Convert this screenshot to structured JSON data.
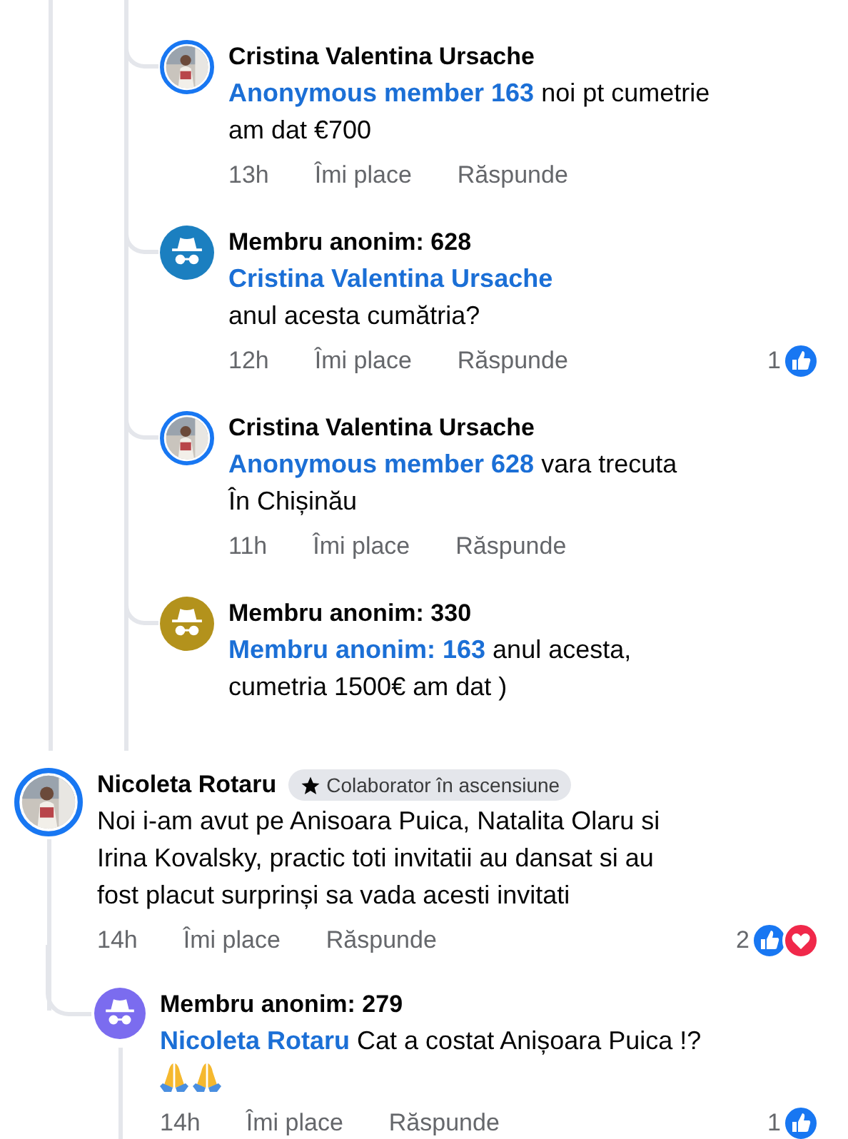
{
  "thread_replies": [
    {
      "author": "Cristina Valentina Ursache",
      "mention": "Anonymous member 163",
      "text": " noi pt cumetrie\nam dat €700",
      "time": "13h",
      "actions": [
        "Îmi place",
        "Răspunde"
      ]
    },
    {
      "author": "Membru anonim: 628",
      "avatar": {
        "kind": "anonymous",
        "color": "#1b7fc0"
      },
      "mention": "Cristina Valentina Ursache",
      "text": "\nanul acesta cumătria?",
      "time": "12h",
      "actions": [
        "Îmi place",
        "Răspunde"
      ],
      "reactions": {
        "count": "1",
        "types": [
          {
            "kind": "like"
          }
        ]
      }
    },
    {
      "author": "Cristina Valentina Ursache",
      "mention": "Anonymous member 628",
      "text": " vara trecuta\nÎn Chișinău",
      "time": "11h",
      "actions": [
        "Îmi place",
        "Răspunde"
      ]
    },
    {
      "author": "Membru anonim: 330",
      "avatar": {
        "kind": "anonymous",
        "color": "#b3921c"
      },
      "mention": "Membru anonim: 163",
      "text": " anul acesta,\ncumetria 1500€ am dat )"
    }
  ],
  "comment": {
    "author": "Nicoleta Rotaru",
    "badge": "Colaborator în ascensiune",
    "text": "Noi i-am avut pe Anisoara Puica, Natalita Olaru si\nIrina Kovalsky, practic toti invitatii au dansat si au\nfost placut surprinși sa vada acesti invitati",
    "time": "14h",
    "actions": [
      "Îmi place",
      "Răspunde"
    ],
    "reactions": {
      "count": "2",
      "types": [
        {
          "kind": "like"
        },
        {
          "kind": "love"
        }
      ]
    },
    "replies": [
      {
        "author": "Membru anonim: 279",
        "avatar": {
          "kind": "anonymous",
          "color": "#7b6cef"
        },
        "mention": "Nicoleta Rotaru",
        "text": " Cat a costat Anișoara Puica !?",
        "trailing_icons": [
          {
            "kind": "praying-hands"
          },
          {
            "kind": "praying-hands"
          }
        ],
        "time": "14h",
        "actions": [
          "Îmi place",
          "Răspunde"
        ],
        "reactions": {
          "count": "1",
          "types": [
            {
              "kind": "like"
            }
          ]
        }
      }
    ]
  }
}
